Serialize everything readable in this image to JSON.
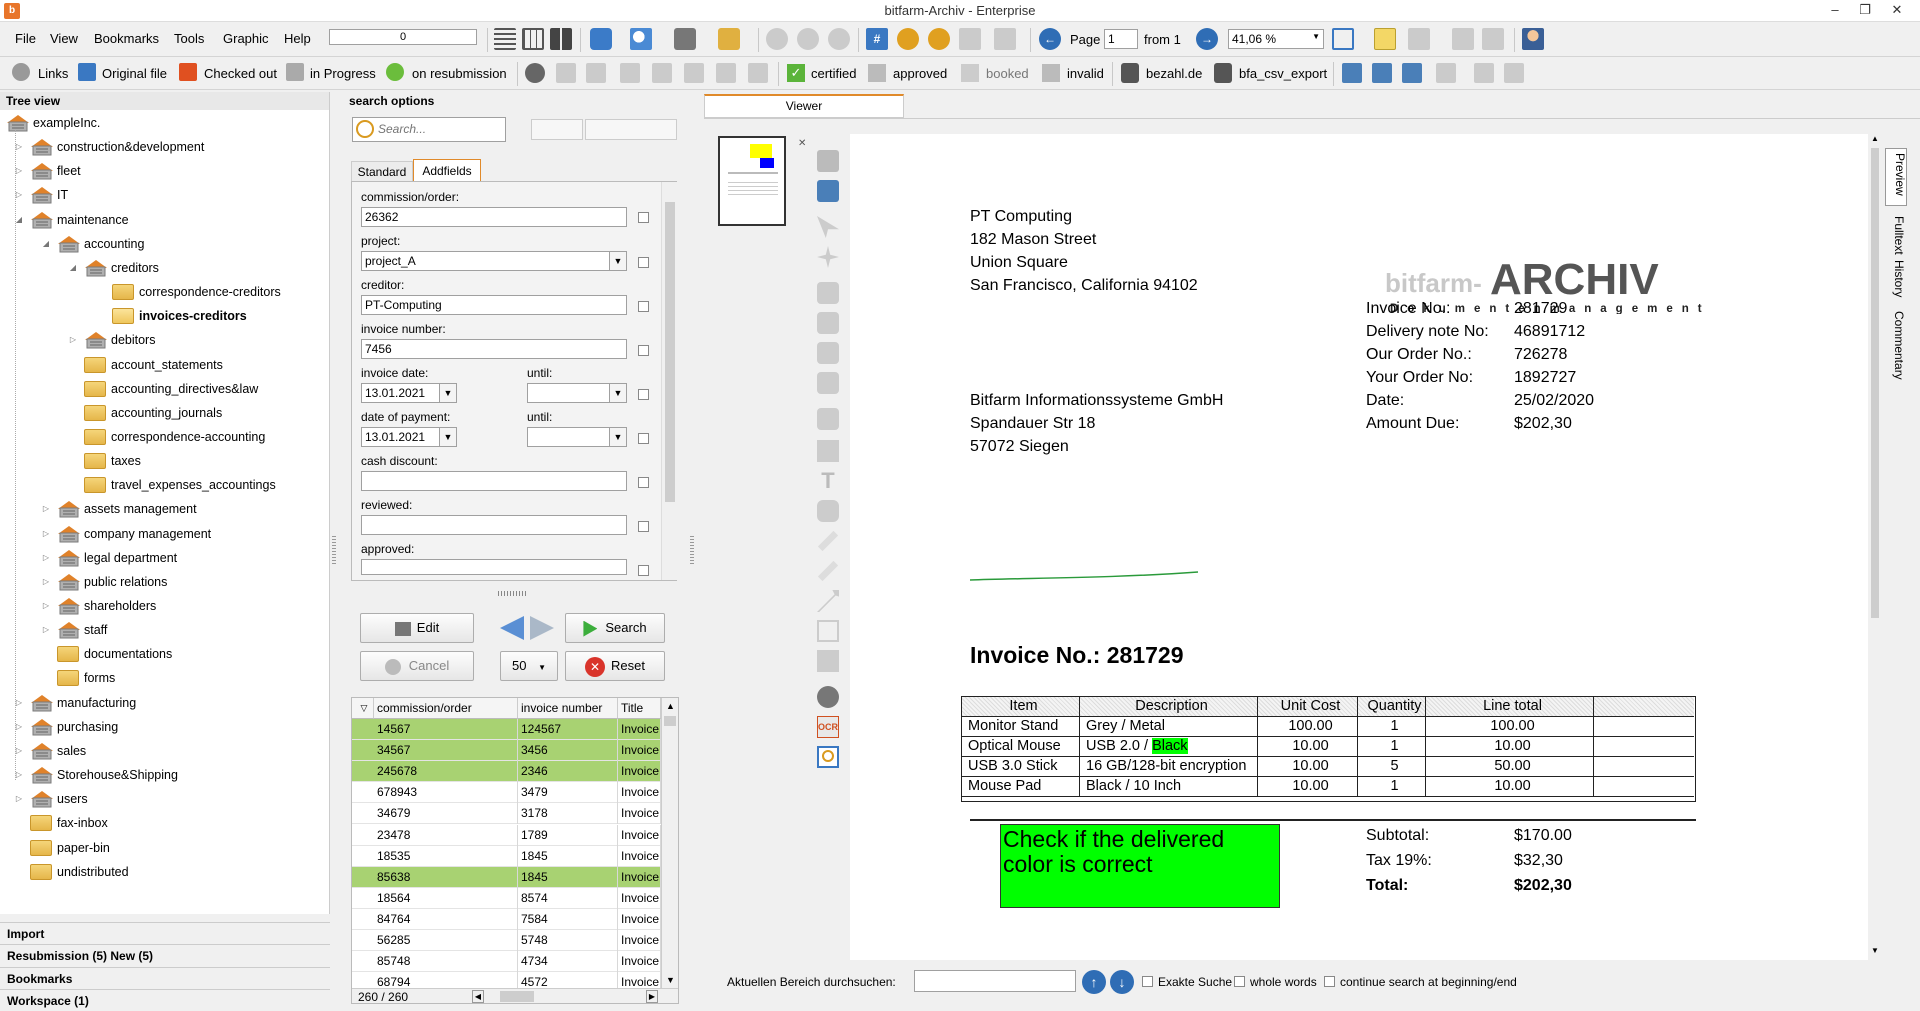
{
  "window": {
    "title": "bitfarm-Archiv - Enterprise",
    "app_icon": "b"
  },
  "menu": [
    "File",
    "View",
    "Bookmarks",
    "Tools",
    "Graphic",
    "Help"
  ],
  "toolbar1": {
    "progress_value": "0",
    "page_label": "Page",
    "page_value": "1",
    "from_label": "from 1",
    "zoom_value": "41,06 %"
  },
  "toolbar2": {
    "links": "Links",
    "original_file": "Original file",
    "checked_out": "Checked out",
    "in_progress": "in Progress",
    "on_resubmission": "on resubmission",
    "certified": "certified",
    "approved": "approved",
    "booked": "booked",
    "invalid": "invalid",
    "bezahl": "bezahl.de",
    "bfa_csv_export": "bfa_csv_export"
  },
  "tree": {
    "header": "Tree view",
    "nodes": [
      {
        "label": "exampleInc."
      },
      {
        "label": "construction&development"
      },
      {
        "label": "fleet"
      },
      {
        "label": "IT"
      },
      {
        "label": "maintenance"
      },
      {
        "label": "accounting"
      },
      {
        "label": "creditors"
      },
      {
        "label": "correspondence-creditors"
      },
      {
        "label": "invoices-creditors"
      },
      {
        "label": "debitors"
      },
      {
        "label": "account_statements"
      },
      {
        "label": "accounting_directives&law"
      },
      {
        "label": "accounting_journals"
      },
      {
        "label": "correspondence-accounting"
      },
      {
        "label": "taxes"
      },
      {
        "label": "travel_expenses_accountings"
      },
      {
        "label": "assets management"
      },
      {
        "label": "company management"
      },
      {
        "label": "legal department"
      },
      {
        "label": "public relations"
      },
      {
        "label": "shareholders"
      },
      {
        "label": "staff"
      },
      {
        "label": "documentations"
      },
      {
        "label": "forms"
      },
      {
        "label": "manufacturing"
      },
      {
        "label": "purchasing"
      },
      {
        "label": "sales"
      },
      {
        "label": "Storehouse&Shipping"
      },
      {
        "label": "users"
      },
      {
        "label": "fax-inbox"
      },
      {
        "label": "paper-bin"
      },
      {
        "label": "undistributed"
      }
    ],
    "bottom": [
      "Import",
      "Resubmission (5)  New (5)",
      "Bookmarks",
      "Workspace (1)"
    ]
  },
  "search": {
    "header": "search options",
    "placeholder": "Search...",
    "tabs": [
      "Standard",
      "Addfields"
    ],
    "fields": {
      "commission_label": "commission/order:",
      "commission_value": "26362",
      "project_label": "project:",
      "project_value": "project_A",
      "creditor_label": "creditor:",
      "creditor_value": "PT-Computing",
      "invoice_number_label": "invoice number:",
      "invoice_number_value": "7456",
      "invoice_date_label": "invoice date:",
      "invoice_date_value": "13.01.2021",
      "until_label": "until:",
      "payment_date_label": "date of payment:",
      "payment_date_value": "13.01.2021",
      "cash_discount_label": "cash discount:",
      "reviewed_label": "reviewed:",
      "approved_label": "approved:"
    },
    "buttons": {
      "edit": "Edit",
      "search": "Search",
      "cancel": "Cancel",
      "reset": "Reset",
      "page_size": "50"
    }
  },
  "results": {
    "columns": [
      "commission/order",
      "invoice number",
      "Title"
    ],
    "rows": [
      {
        "c": "14567",
        "n": "124567",
        "t": "Invoice",
        "green": true
      },
      {
        "c": "34567",
        "n": "3456",
        "t": "Invoice",
        "green": true
      },
      {
        "c": "245678",
        "n": "2346",
        "t": "Invoice",
        "green": true
      },
      {
        "c": "678943",
        "n": "3479",
        "t": "Invoice",
        "green": false
      },
      {
        "c": "34679",
        "n": "3178",
        "t": "Invoice",
        "green": false
      },
      {
        "c": "23478",
        "n": "1789",
        "t": "Invoice",
        "green": false
      },
      {
        "c": "18535",
        "n": "1845",
        "t": "Invoice",
        "green": false
      },
      {
        "c": "85638",
        "n": "1845",
        "t": "Invoice",
        "green": true
      },
      {
        "c": "18564",
        "n": "8574",
        "t": "Invoice",
        "green": false
      },
      {
        "c": "84764",
        "n": "7584",
        "t": "Invoice",
        "green": false
      },
      {
        "c": "56285",
        "n": "5748",
        "t": "Invoice",
        "green": false
      },
      {
        "c": "85748",
        "n": "4734",
        "t": "Invoice",
        "green": false
      },
      {
        "c": "68794",
        "n": "4572",
        "t": "Invoice",
        "green": false
      }
    ],
    "count": "260 / 260"
  },
  "viewer": {
    "tab": "Viewer",
    "side_tabs": [
      "Preview",
      "Fulltext",
      "History",
      "Commentary"
    ],
    "search_label": "Aktuellen Bereich durchsuchen:",
    "exact_search": "Exakte Suche",
    "whole_words": "whole words",
    "continue_search": "continue search at beginning/end"
  },
  "document": {
    "sender": [
      "PT Computing",
      "182 Mason Street",
      "Union Square",
      "San Francisco, California 94102"
    ],
    "logo_top": "bitfarm-ARCHIV",
    "logo_bottom": "Dokumentenmanagement",
    "meta_labels": [
      "Invoice No.:",
      "Delivery note No:",
      "Our Order No.:",
      "Your Order No:",
      "Date:",
      "Amount Due:"
    ],
    "meta_values": [
      "281729",
      "46891712",
      "726278",
      "1892727",
      "25/02/2020",
      "$202,30"
    ],
    "recipient": [
      "Bitfarm Informationssysteme GmbH",
      "Spandauer Str 18",
      "57072 Siegen"
    ],
    "heading": "Invoice No.: 281729",
    "table_headers": [
      "Item",
      "Description",
      "Unit Cost",
      "Quantity",
      "Line total"
    ],
    "table_rows": [
      [
        "Monitor Stand",
        "Grey / Metal",
        "100.00",
        "1",
        "100.00"
      ],
      [
        "Optical Mouse",
        "USB 2.0 / ",
        "10.00",
        "1",
        "10.00"
      ],
      [
        "USB 3.0 Stick",
        "16 GB/128-bit encryption",
        "10.00",
        "5",
        "50.00"
      ],
      [
        "Mouse Pad",
        "Black / 10 Inch",
        "10.00",
        "1",
        "10.00"
      ]
    ],
    "highlight_word": "Black",
    "note": "Check if the delivered color is correct",
    "subtotal_label": "Subtotal:",
    "subtotal_value": "$170.00",
    "tax_label": "Tax 19%:",
    "tax_value": "$32,30",
    "total_label": "Total:",
    "total_value": "$202,30"
  },
  "colors": {
    "highlight_green": "#00ff00",
    "row_green": "#a8d272",
    "accent_blue": "#2f6db5"
  }
}
